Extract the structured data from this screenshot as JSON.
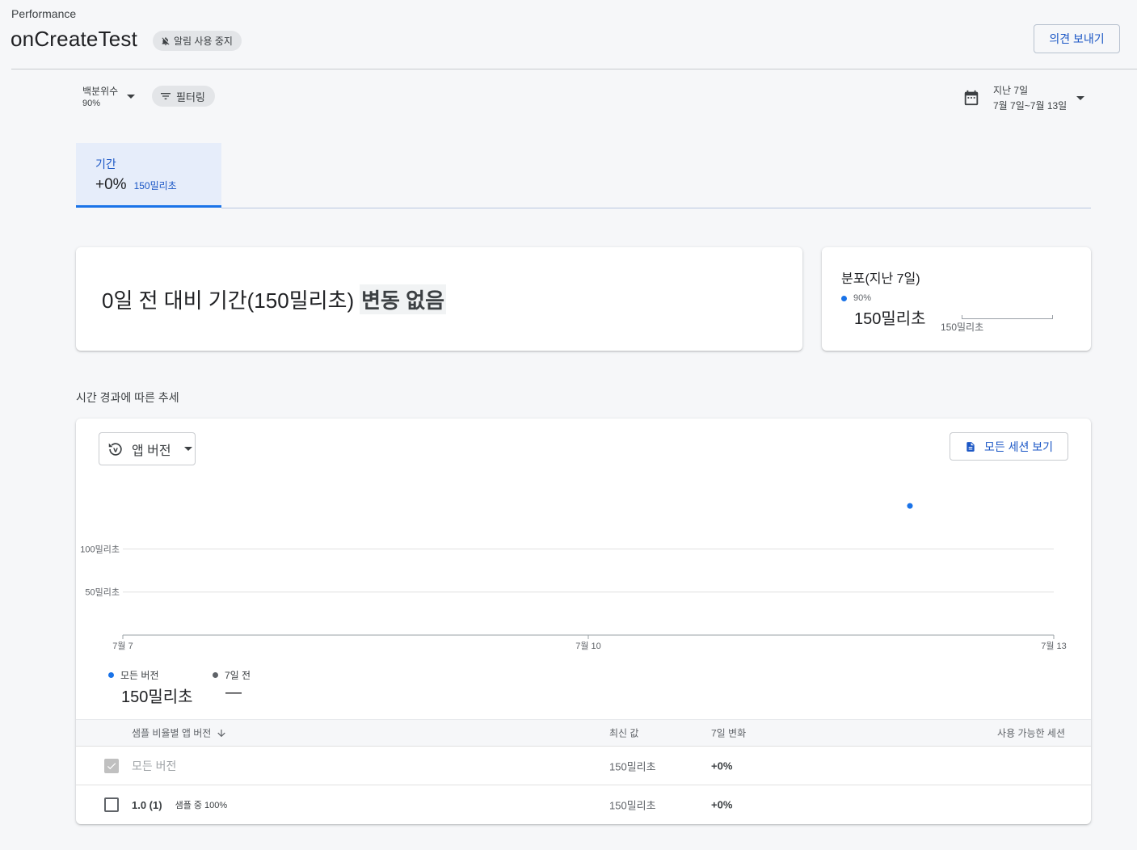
{
  "header": {
    "section_label": "Performance",
    "title": "onCreateTest",
    "alert_chip": "알림 사용 중지",
    "feedback_button": "의견 보내기"
  },
  "filters": {
    "percentile_label": "백분위수",
    "percentile_value": "90%",
    "filter_chip": "필터링",
    "date_label": "지난 7일",
    "date_value": "7월 7일~7월 13일"
  },
  "metric_tab": {
    "label": "기간",
    "change": "+0%",
    "value": "150밀리초"
  },
  "summary": {
    "text": "0일 전 대비 기간(150밀리초)",
    "highlight": "변동 없음"
  },
  "distribution": {
    "title": "분포(지난 7일)",
    "percentile": "90%",
    "value": "150밀리초",
    "axis_label": "150밀리초"
  },
  "trend": {
    "heading": "시간 경과에 따른 추세",
    "version_select": "앱 버전",
    "all_sessions_button": "모든 세션 보기",
    "legend": [
      {
        "name": "모든 버전",
        "value": "150밀리초",
        "color": "#1a73e8"
      },
      {
        "name": "7일 전",
        "value": "—",
        "color": "#5f6368"
      }
    ]
  },
  "chart_data": {
    "type": "scatter",
    "x_categories": [
      "7월 7",
      "7월 10",
      "7월 13"
    ],
    "y_ticks": [
      "50밀리초",
      "100밀리초"
    ],
    "ylim": [
      0,
      150
    ],
    "series": [
      {
        "name": "모든 버전",
        "points": [
          {
            "x": "7월 12",
            "y": 150
          }
        ],
        "color": "#1a73e8"
      }
    ],
    "grid": true
  },
  "table": {
    "columns": [
      "샘플 비율별 앱 버전",
      "최신 값",
      "7일 변화",
      "사용 가능한 세션"
    ],
    "rows": [
      {
        "name": "모든 버전",
        "sample": "",
        "latest": "150밀리초",
        "change": "+0%",
        "sessions": "",
        "checked": true
      },
      {
        "name": "1.0 (1)",
        "sample": "샘플 중 100%",
        "latest": "150밀리초",
        "change": "+0%",
        "sessions": "",
        "checked": false
      }
    ]
  }
}
